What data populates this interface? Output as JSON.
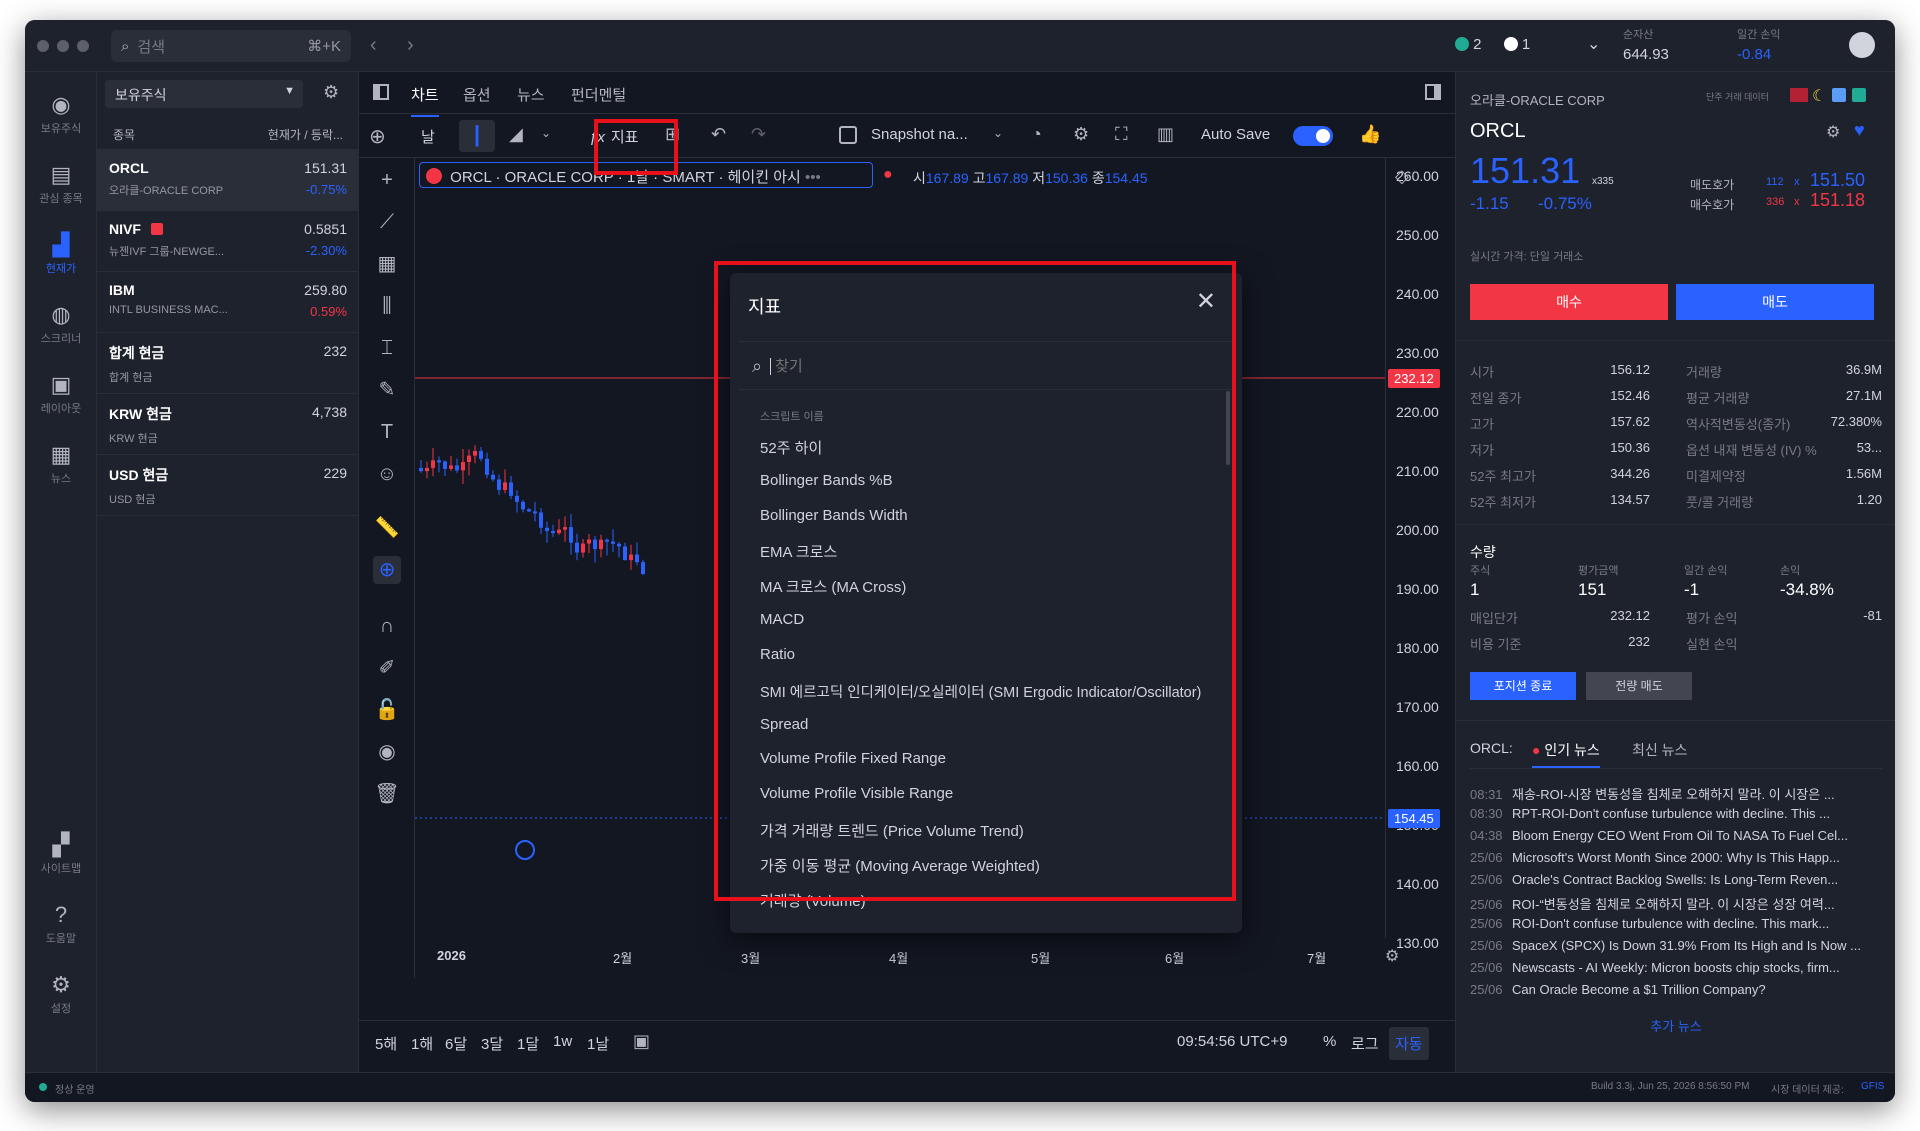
{
  "titlebar": {
    "search_placeholder": "검색",
    "shortcut": "⌘+K",
    "badge_green": "2",
    "badge_check": "1",
    "net_assets_label": "순자산",
    "net_assets": "644.93",
    "daily_pl_label": "일간 손익",
    "daily_pl": "-0.84"
  },
  "sidebar": {
    "items": [
      {
        "label": "보유주식",
        "icon": "wallet-icon"
      },
      {
        "label": "관심 종목",
        "icon": "list-icon"
      },
      {
        "label": "현재가",
        "icon": "chart-icon"
      },
      {
        "label": "스크리너",
        "icon": "globe-icon"
      },
      {
        "label": "레이아웃",
        "icon": "layout-icon"
      },
      {
        "label": "뉴스",
        "icon": "news-icon"
      },
      {
        "label": "사이트맵",
        "icon": "grid-icon"
      },
      {
        "label": "도움말",
        "icon": "help-icon"
      },
      {
        "label": "설정",
        "icon": "gear-icon"
      }
    ]
  },
  "holdings": {
    "dropdown": "보유주식",
    "col1": "종목",
    "col2": "현재가 / 등락...",
    "rows": [
      {
        "sym": "ORCL",
        "name": "오라클-ORACLE CORP",
        "price": "151.31",
        "chg": "-0.75%",
        "dir": "neg"
      },
      {
        "sym": "NIVF",
        "name": "뉴젠IVF 그룹-NEWGE...",
        "price": "0.5851",
        "chg": "-2.30%",
        "dir": "neg"
      },
      {
        "sym": "IBM",
        "name": "INTL BUSINESS MAC...",
        "price": "259.80",
        "chg": "0.59%",
        "dir": "pos"
      },
      {
        "sym": "합계 현금",
        "name": "합계 현금",
        "price": "232",
        "chg": "",
        "dir": ""
      },
      {
        "sym": "KRW 현금",
        "name": "KRW 현금",
        "price": "4,738",
        "chg": "",
        "dir": ""
      },
      {
        "sym": "USD 현금",
        "name": "USD 현금",
        "price": "229",
        "chg": "",
        "dir": ""
      }
    ]
  },
  "tabs": [
    "차트",
    "옵션",
    "뉴스",
    "펀더멘털"
  ],
  "toolbar": {
    "interval": "날",
    "indicators": "지표",
    "snapshot": "Snapshot na...",
    "autosave": "Auto Save"
  },
  "legend": {
    "title": "ORCL · ORACLE CORP · 1날 · SMART · 헤이킨 아시",
    "open_label": "시",
    "open": "167.89",
    "high_label": "고",
    "high": "167.89",
    "low_label": "저",
    "low": "150.36",
    "close_label": "종",
    "close": "154.45"
  },
  "yaxis": [
    "260.00",
    "250.00",
    "240.00",
    "230.00",
    "220.00",
    "210.00",
    "200.00",
    "190.00",
    "180.00",
    "170.00",
    "160.00",
    "150.00",
    "140.00",
    "130.00"
  ],
  "price_tags": {
    "red": "232.12",
    "blue": "154.45"
  },
  "xaxis": [
    "2026",
    "2월",
    "3월",
    "4월",
    "5월",
    "6월",
    "7월"
  ],
  "bottom": {
    "ranges": [
      "5해",
      "1해",
      "6달",
      "3달",
      "1달",
      "1w",
      "1날"
    ],
    "time": "09:54:56 UTC+9",
    "pct": "%",
    "log": "로그",
    "auto": "자동"
  },
  "modal": {
    "title": "지표",
    "search_placeholder": "찾기",
    "section": "스크립트 이름",
    "items": [
      "52주 하이",
      "Bollinger Bands %B",
      "Bollinger Bands Width",
      "EMA 크로스",
      "MA 크로스 (MA Cross)",
      "MACD",
      "Ratio",
      "SMI 에르고딕 인디케이터/오실레이터 (SMI Ergodic Indicator/Oscillator)",
      "Spread",
      "Volume Profile Fixed Range",
      "Volume Profile Visible Range",
      "가격 거래량 트렌드 (Price Volume Trend)",
      "가중 이동 평균 (Moving Average Weighted)",
      "거래량 (Volume)"
    ]
  },
  "quote": {
    "header": "오라클-ORACLE CORP",
    "delay": "단주 거래 데이터",
    "ticker": "ORCL",
    "price": "151.31",
    "mult": "x335",
    "chg": "-1.15",
    "chgpct": "-0.75%",
    "bid_label": "매도호가",
    "bid_size": "112",
    "bid_x": "x",
    "bid": "151.50",
    "ask_label": "매수호가",
    "ask_size": "336",
    "ask_x": "x",
    "ask": "151.18",
    "realtime": "실시간 가격: 단일 거래소",
    "buy": "매수",
    "sell": "매도"
  },
  "stats_left": [
    [
      "시가",
      "156.12"
    ],
    [
      "전일 종가",
      "152.46"
    ],
    [
      "고가",
      "157.62"
    ],
    [
      "저가",
      "150.36"
    ],
    [
      "52주 최고가",
      "344.26"
    ],
    [
      "52주 최저가",
      "134.57"
    ]
  ],
  "stats_right": [
    [
      "거래량",
      "36.9M"
    ],
    [
      "평균 거래량",
      "27.1M"
    ],
    [
      "역사적변동성(종가)",
      "72.380%"
    ],
    [
      "옵션 내재 변동성 (IV) %",
      "53..."
    ],
    [
      "미결제약정",
      "1.56M"
    ],
    [
      "풋/콜 거래량",
      "1.20"
    ]
  ],
  "position": {
    "title": "수량",
    "h1": "주식",
    "h2": "평가금액",
    "h3": "일간 손익",
    "h4": "손익",
    "v1": "1",
    "v2": "151",
    "v3": "-1",
    "v4": "-34.8%",
    "avg_label": "매입단가",
    "avg": "232.12",
    "upl_label": "평가 손익",
    "upl": "-81",
    "cost_label": "비용 기준",
    "cost": "232",
    "rpl_label": "실현 손익",
    "close_btn": "포지션 종료",
    "sell_all": "전량 매도"
  },
  "newsbox": {
    "label": "ORCL:",
    "tab1": "인기 뉴스",
    "tab2": "최신 뉴스",
    "more": "추가 뉴스",
    "items": [
      [
        "08:31",
        "재송-ROI-시장 변동성을 침체로 오해하지 말라. 이 시장은 ..."
      ],
      [
        "08:30",
        "RPT-ROI-Don't confuse turbulence with decline. This ..."
      ],
      [
        "04:38",
        "Bloom Energy CEO Went From Oil To NASA To Fuel Cel..."
      ],
      [
        "25/06",
        "Microsoft's Worst Month Since 2000: Why Is This Happ..."
      ],
      [
        "25/06",
        "Oracle's Contract Backlog Swells: Is Long-Term Reven..."
      ],
      [
        "25/06",
        "ROI-“변동성을 침체로 오해하지 말라. 이 시장은 성장 여력..."
      ],
      [
        "25/06",
        "ROI-Don't confuse turbulence with decline. This mark..."
      ],
      [
        "25/06",
        "SpaceX (SPCX) Is Down 31.9% From Its High and Is Now ..."
      ],
      [
        "25/06",
        "Newscasts - AI Weekly: Micron boosts chip stocks, firm..."
      ],
      [
        "25/06",
        "Can Oracle Become a $1 Trillion Company?"
      ]
    ]
  },
  "status": {
    "left": "정상 운영",
    "build": "Build 3.3j, Jun 25, 2026 8:56:50 PM",
    "provider_label": "시장 데이터 제공:",
    "provider": "GFIS"
  },
  "colors": {
    "bg": "#131722",
    "panel": "#1e222d",
    "up": "#f23645",
    "down": "#2962ff",
    "highlight": "#e8101a"
  }
}
